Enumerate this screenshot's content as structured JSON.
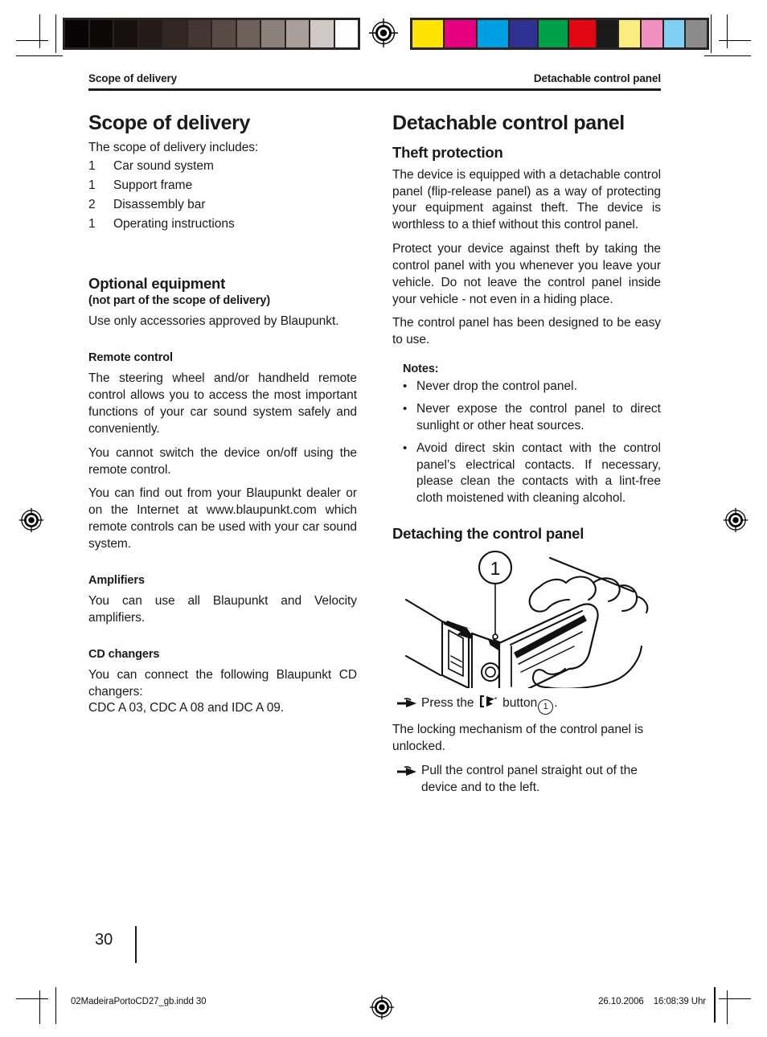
{
  "running_head": {
    "left": "Scope of delivery",
    "right": "Detachable control panel"
  },
  "left_column": {
    "title": "Scope of delivery",
    "intro": "The scope of delivery includes:",
    "delivery_items": [
      {
        "qty": "1",
        "name": "Car sound system"
      },
      {
        "qty": "1",
        "name": "Support frame"
      },
      {
        "qty": "2",
        "name": "Disassembly bar"
      },
      {
        "qty": "1",
        "name": "Operating instructions"
      }
    ],
    "optional": {
      "heading": "Optional equipment",
      "subheading": "(not part of the scope of delivery)",
      "body": "Use only accessories approved by Blaupunkt."
    },
    "remote": {
      "heading": "Remote control",
      "p1": "The steering wheel and/or handheld remote control allows you to access the most important functions of your car sound system safely and conveniently.",
      "p2": "You cannot switch the device on/off using the remote control.",
      "p3": "You can find out from your Blaupunkt dealer or on the Internet at www.blaupunkt.com which remote controls can be used with your car sound system."
    },
    "amplifiers": {
      "heading": "Amplifiers",
      "body": "You can use all Blaupunkt and Velocity amplifiers."
    },
    "cd_changers": {
      "heading": "CD changers",
      "body": "You can connect the following Blaupunkt CD changers:",
      "models": "CDC A 03, CDC A 08 and IDC A 09."
    }
  },
  "right_column": {
    "title": "Detachable control panel",
    "theft": {
      "heading": "Theft protection",
      "p1": "The device is equipped with a detachable control panel (flip-release panel) as a way of protecting your equipment against theft. The device is worthless to a thief without this control panel.",
      "p2": "Protect your device against theft by taking the control panel with you whenever you leave your vehicle. Do not leave the control panel inside your vehicle - not even in a hiding place.",
      "p3": "The control panel has been designed to be easy to use."
    },
    "notes": {
      "heading": "Notes:",
      "bullet": "•",
      "items": [
        "Never drop the control panel.",
        "Never expose the control panel to direct sunlight or other heat sources.",
        "Avoid direct skin contact with the control panel’s electrical contacts. If necessary, please clean the contacts with a lint-free cloth moistened with cleaning alcohol."
      ]
    },
    "detaching": {
      "heading": "Detaching the control panel",
      "figure_callout": "1",
      "step1_before": "Press the",
      "step1_middle": "button",
      "step1_callout": "1",
      "step1_after": ".",
      "result": "The locking mechanism of the control panel is unlocked.",
      "step2": "Pull the control panel straight out of the device and to the left."
    }
  },
  "page_number": "30",
  "colophon": {
    "file": "02MadeiraPortoCD27_gb.indd   30",
    "date": "26.10.2006",
    "time": "16:08:39 Uhr"
  },
  "prepress": {
    "grey_steps": [
      "#060404",
      "#0d0908",
      "#17100e",
      "#241b18",
      "#332724",
      "#443733",
      "#584a45",
      "#6e615c",
      "#8d817c",
      "#a99e99",
      "#cfc8c4",
      "#ffffff"
    ],
    "color_steps": [
      "#fde300",
      "#e5007e",
      "#009fe3",
      "#2e3192",
      "#00a04a",
      "#e30613",
      "#1a1a1a",
      "#faec7e",
      "#f191c0",
      "#7fd0f2",
      "#8c8c8c"
    ]
  }
}
